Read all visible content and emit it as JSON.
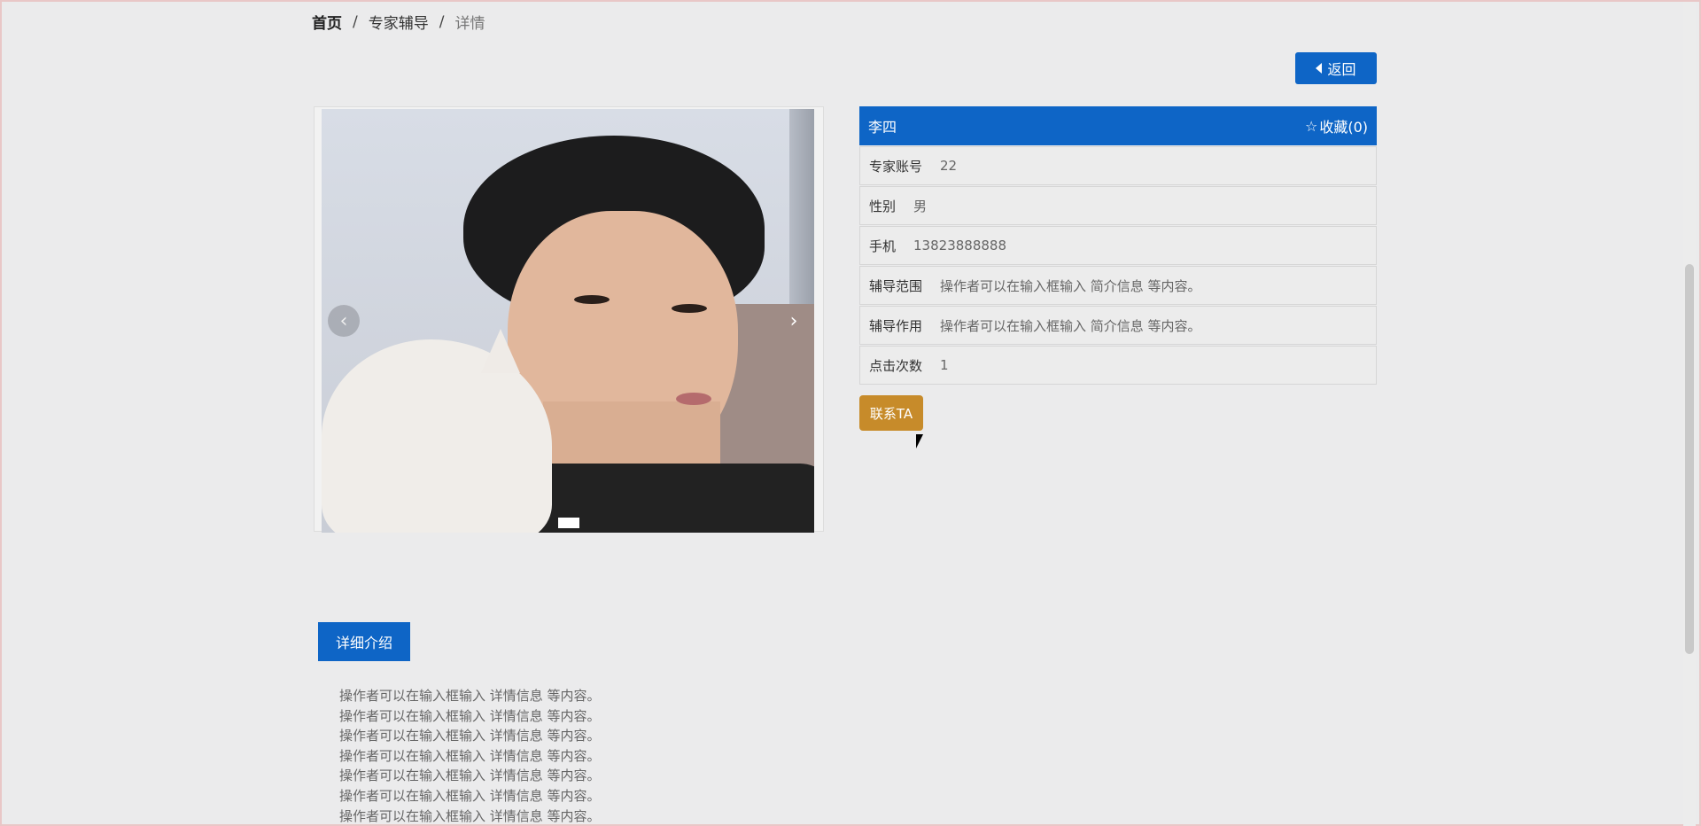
{
  "breadcrumb": {
    "home": "首页",
    "section": "专家辅导",
    "current": "详情",
    "sep": "/"
  },
  "back_button": {
    "label": "返回"
  },
  "carousel": {
    "prev": "‹",
    "next": "›",
    "slides_total": 1,
    "active_index": 0
  },
  "expert": {
    "name": "李四",
    "favorite_label": "收藏(0)",
    "fields": [
      {
        "label": "专家账号",
        "value": "22"
      },
      {
        "label": "性别",
        "value": "男"
      },
      {
        "label": "手机",
        "value": "13823888888"
      },
      {
        "label": "辅导范围",
        "value": "操作者可以在输入框输入 简介信息 等内容。"
      },
      {
        "label": "辅导作用",
        "value": "操作者可以在输入框输入 简介信息 等内容。"
      },
      {
        "label": "点击次数",
        "value": "1"
      }
    ],
    "contact_button": "联系TA"
  },
  "detail": {
    "tab_label": "详细介绍",
    "lines": [
      "操作者可以在输入框输入  详情信息  等内容。",
      "操作者可以在输入框输入  详情信息  等内容。",
      "操作者可以在输入框输入  详情信息  等内容。",
      "操作者可以在输入框输入  详情信息  等内容。",
      "操作者可以在输入框输入  详情信息  等内容。",
      "操作者可以在输入框输入  详情信息  等内容。",
      "操作者可以在输入框输入  详情信息  等内容。"
    ]
  },
  "colors": {
    "primary": "#0e65c6",
    "contact": "#c78b2a",
    "background": "#ebebec"
  }
}
